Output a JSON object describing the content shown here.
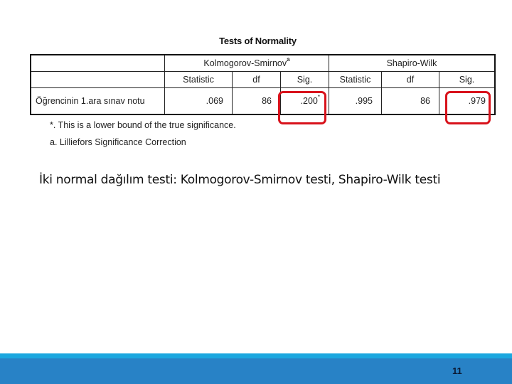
{
  "table": {
    "title": "Tests of Normality",
    "groups": [
      {
        "name": "Kolmogorov-Smirnov",
        "superscript": "a"
      },
      {
        "name": "Shapiro-Wilk",
        "superscript": ""
      }
    ],
    "columns": [
      "Statistic",
      "df",
      "Sig.",
      "Statistic",
      "df",
      "Sig."
    ],
    "rows": [
      {
        "label": "Öğrencinin 1.ara sınav notu",
        "ks_statistic": ".069",
        "ks_df": "86",
        "ks_sig": ".200",
        "ks_sig_mark": "*",
        "sw_statistic": ".995",
        "sw_df": "86",
        "sw_sig": ".979"
      }
    ],
    "footnotes": [
      "*. This is a lower bound of the true significance.",
      "a. Lilliefors Significance Correction"
    ]
  },
  "highlights": {
    "color": "#d8121b",
    "cells": [
      "ks_sig",
      "sw_sig"
    ]
  },
  "caption": "İki normal dağılım testi: Kolmogorov-Smirnov testi, Shapiro-Wilk testi",
  "footer": {
    "page_number": "11",
    "bar_color": "#2882c6",
    "accent_color": "#1ba7df"
  }
}
